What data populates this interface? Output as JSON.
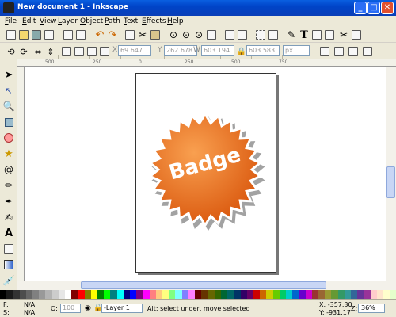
{
  "window": {
    "title": "New document 1 - Inkscape",
    "buttons": [
      "_",
      "□",
      "✕"
    ]
  },
  "menu": [
    "File",
    "Edit",
    "View",
    "Layer",
    "Object",
    "Path",
    "Text",
    "Effects",
    "Help"
  ],
  "toolbar2": {
    "x_label": "X",
    "x_value": "69.647",
    "y_label": "Y",
    "y_value": "262.678",
    "w_label": "W",
    "w_value": "603.194",
    "h_label": "H",
    "h_value": "603.583",
    "units": "px"
  },
  "ruler_top": [
    "500",
    "250",
    "0",
    "250",
    "500",
    "750"
  ],
  "badge": {
    "text": "Badge",
    "color_outer": "#c94a0a",
    "color_inner": "#f7841e"
  },
  "palette": [
    "#000000",
    "#1a1a1a",
    "#333333",
    "#4d4d4d",
    "#666666",
    "#808080",
    "#999999",
    "#b3b3b3",
    "#cccccc",
    "#e6e6e6",
    "#ffffff",
    "#800000",
    "#ff0000",
    "#808000",
    "#ffff00",
    "#008000",
    "#00ff00",
    "#008080",
    "#00ffff",
    "#000080",
    "#0000ff",
    "#800080",
    "#ff00ff",
    "#ff8080",
    "#ffcc80",
    "#ffff80",
    "#80ff80",
    "#80ffff",
    "#8080ff",
    "#ff80ff",
    "#660000",
    "#663300",
    "#666600",
    "#336600",
    "#006633",
    "#006666",
    "#003366",
    "#330066",
    "#660066",
    "#cc0000",
    "#cc6600",
    "#cccc00",
    "#66cc00",
    "#00cc66",
    "#00cccc",
    "#0066cc",
    "#6600cc",
    "#cc00cc",
    "#993333",
    "#996633",
    "#999933",
    "#669933",
    "#339966",
    "#339999",
    "#336699",
    "#663399",
    "#993399",
    "#ffcccc",
    "#ffe5cc",
    "#ffffcc",
    "#e5ffcc"
  ],
  "status": {
    "fill_label": "F:",
    "fill_value": "N/A",
    "stroke_label": "S:",
    "stroke_value": "N/A",
    "opacity_label": "O:",
    "opacity_value": "100",
    "layer": "-Layer 1",
    "message": "Alt: select under, move selected",
    "coords": "X: -357.30",
    "coords2": "Y: -931.17",
    "zoom_label": "Z:",
    "zoom": "36%"
  }
}
